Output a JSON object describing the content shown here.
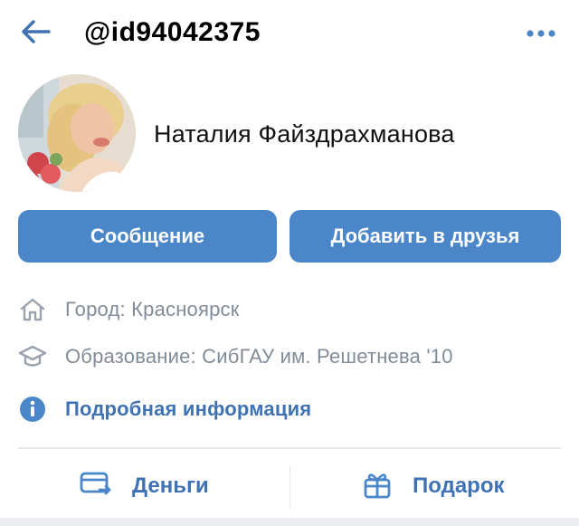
{
  "header": {
    "username": "@id94042375",
    "back_icon": "arrow-left-icon",
    "more_icon": "more-horizontal-icon"
  },
  "profile": {
    "name": "Наталия Файздрахманова",
    "avatar_icon": "profile-photo"
  },
  "actions": {
    "message_label": "Сообщение",
    "add_friend_label": "Добавить в друзья"
  },
  "info": {
    "city": "Город: Красноярск",
    "education": "Образование: СибГАУ им. Решетнева '10",
    "details_link": "Подробная информация"
  },
  "footer": {
    "money_label": "Деньги",
    "gift_label": "Подарок"
  },
  "colors": {
    "accent": "#4a86c8",
    "link": "#3f72b3",
    "muted": "#818c99"
  }
}
